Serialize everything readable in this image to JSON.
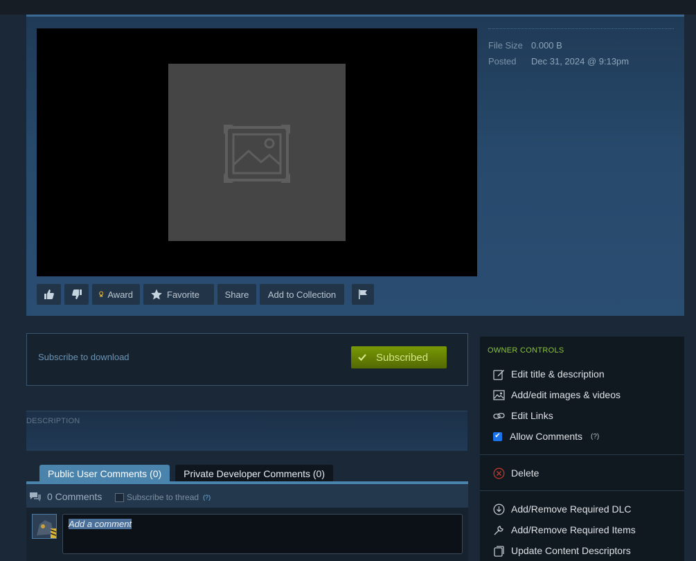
{
  "meta": {
    "file_size_label": "File Size",
    "file_size_value": "0.000 B",
    "posted_label": "Posted",
    "posted_value": "Dec 31, 2024 @ 9:13pm"
  },
  "actions": {
    "upvote_icon": "thumbs-up-icon",
    "downvote_icon": "thumbs-down-icon",
    "award": "Award",
    "favorite": "Favorite",
    "share": "Share",
    "add_to_collection": "Add to Collection",
    "report_icon": "flag-icon"
  },
  "subscribe": {
    "label": "Subscribe to download",
    "button": "Subscribed"
  },
  "description": {
    "label": "DESCRIPTION"
  },
  "comments": {
    "tabs": [
      "Public User Comments (0)",
      "Private Developer Comments (0)"
    ],
    "count": "0 Comments",
    "subscribe_thread": "Subscribe to thread",
    "help": "(?)",
    "input_placeholder": "Add a comment"
  },
  "owner": {
    "heading": "OWNER CONTROLS",
    "items": [
      "Edit title & description",
      "Add/edit images & videos",
      "Edit Links",
      "Allow Comments",
      "Delete",
      "Add/Remove Required DLC",
      "Add/Remove Required Items",
      "Update Content Descriptors"
    ],
    "allow_comments_help": "(?)",
    "allow_comments_checked": true
  },
  "colors": {
    "accent": "#4a84ad",
    "subscribed_green": "#799905",
    "owner_heading": "#8bc53f",
    "checkbox": "#1a73e8"
  }
}
